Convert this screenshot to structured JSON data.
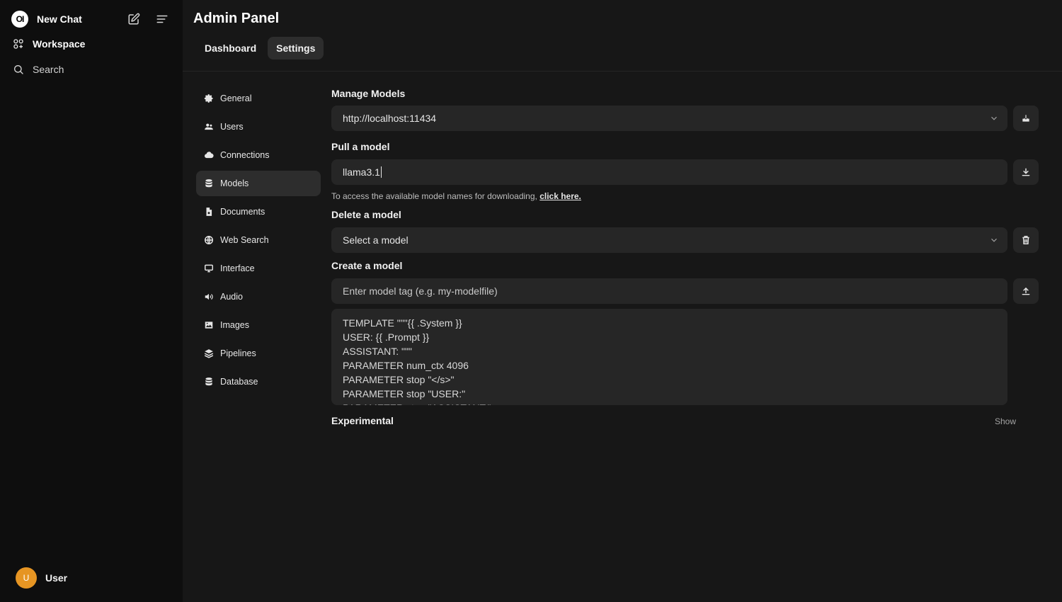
{
  "sidebar": {
    "logo_text": "OI",
    "new_chat_label": "New Chat",
    "workspace_label": "Workspace",
    "search_label": "Search",
    "user": {
      "avatar_initial": "U",
      "name": "User"
    }
  },
  "header": {
    "title": "Admin Panel",
    "tabs": [
      {
        "label": "Dashboard",
        "active": false
      },
      {
        "label": "Settings",
        "active": true
      }
    ]
  },
  "settings_nav": {
    "items": [
      {
        "label": "General",
        "icon": "gear-icon"
      },
      {
        "label": "Users",
        "icon": "users-icon"
      },
      {
        "label": "Connections",
        "icon": "cloud-icon"
      },
      {
        "label": "Models",
        "icon": "database-icon",
        "active": true
      },
      {
        "label": "Documents",
        "icon": "document-icon"
      },
      {
        "label": "Web Search",
        "icon": "globe-icon"
      },
      {
        "label": "Interface",
        "icon": "monitor-icon"
      },
      {
        "label": "Audio",
        "icon": "speaker-icon"
      },
      {
        "label": "Images",
        "icon": "image-icon"
      },
      {
        "label": "Pipelines",
        "icon": "layers-icon"
      },
      {
        "label": "Database",
        "icon": "database-icon"
      }
    ]
  },
  "models": {
    "manage_label": "Manage Models",
    "manage_url_value": "http://localhost:11434",
    "pull_label": "Pull a model",
    "pull_value": "llama3.1",
    "pull_hint": "To access the available model names for downloading,",
    "pull_hint_link": "click here.",
    "delete_label": "Delete a model",
    "delete_placeholder": "Select a model",
    "create_label": "Create a model",
    "create_tag_placeholder": "Enter model tag (e.g. my-modelfile)",
    "modelfile_text": "TEMPLATE \"\"\"{{ .System }}\nUSER: {{ .Prompt }}\nASSISTANT: \"\"\"\nPARAMETER num_ctx 4096\nPARAMETER stop \"</s>\"\nPARAMETER stop \"USER:\"\nPARAMETER stop \"ASSISTANT:\"",
    "experimental_label": "Experimental",
    "experimental_toggle": "Show"
  }
}
